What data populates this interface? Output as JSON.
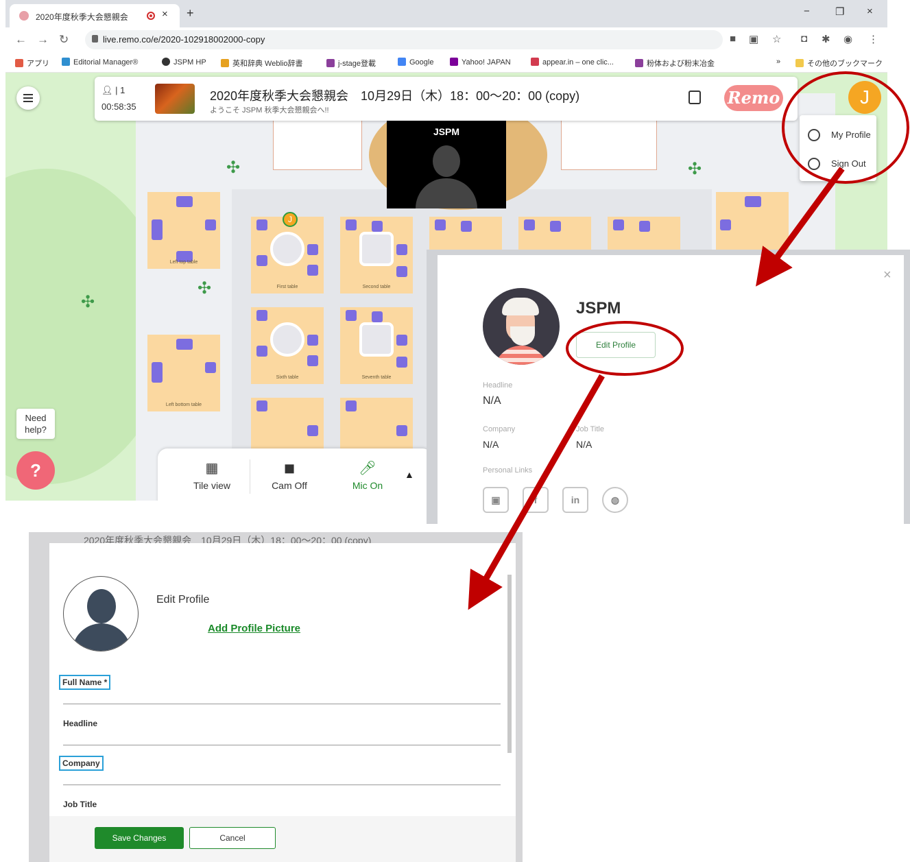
{
  "browser": {
    "tab_title": "2020年度秋季大会懇親会",
    "tab_close": "×",
    "new_tab": "+",
    "window_minimize": "−",
    "window_restore": "❐",
    "window_close": "×",
    "url": "live.remo.co/e/2020-102918002000-copy",
    "bookmarks": [
      {
        "label": "アプリ",
        "color": "#e25b45"
      },
      {
        "label": "Editorial Manager®",
        "color": "#2f8fd0"
      },
      {
        "label": "JSPM HP",
        "color": "#333333"
      },
      {
        "label": "英和辞典 Weblio辞書",
        "color": "#e6a11f"
      },
      {
        "label": "j-stage登載",
        "color": "#8b3f9b"
      },
      {
        "label": "Google",
        "color": "#4285f4"
      },
      {
        "label": "Yahoo! JAPAN",
        "color": "#7b0099"
      },
      {
        "label": "appear.in – one clic...",
        "color": "#d23b4f"
      },
      {
        "label": "粉体および粉末冶金",
        "color": "#8b3f9b"
      }
    ],
    "bookmarks_more": "»",
    "other_bookmarks": "その他のブックマーク"
  },
  "event": {
    "participants": "1",
    "timer": "00:58:35",
    "title": "2020年度秋季大会懇親会　10月29日（木）18：00〜20：00 (copy)",
    "subtitle": "ようこそ JSPM 秋季大会懇親会へ!!",
    "brand": "Remo",
    "user_initial": "J",
    "menu": {
      "my_profile": "My Profile",
      "sign_out": "Sign Out"
    },
    "video_name": "JSPM",
    "tables": [
      "Left top table",
      "First table",
      "Second table",
      "Sixth table",
      "Seventh table",
      "Left bottom table"
    ],
    "need_help": "Need help?",
    "bottom_bar": {
      "tile_view": "Tile view",
      "cam_off": "Cam Off",
      "mic_on": "Mic On"
    }
  },
  "profile": {
    "name": "JSPM",
    "edit_button": "Edit Profile",
    "headline_label": "Headline",
    "headline_value": "N/A",
    "company_label": "Company",
    "company_value": "N/A",
    "job_title_label": "Job Title",
    "job_title_value": "N/A",
    "links_label": "Personal Links",
    "close": "×"
  },
  "edit_profile": {
    "behind_header": "2020年度秋季大会懇親会　10月29日（木）18：00〜20：00 (copy)",
    "title": "Edit Profile",
    "add_picture": "Add Profile Picture",
    "full_name_label": "Full Name *",
    "headline_label": "Headline",
    "company_label": "Company",
    "job_title_label": "Job Title",
    "save": "Save Changes",
    "cancel": "Cancel"
  },
  "colors": {
    "annotation_red": "#c00000",
    "remo_green": "#1f8a2b",
    "remo_pink": "#f38c8c",
    "avatar_orange": "#f5a623",
    "highlight_blue": "#2aa0d8"
  }
}
